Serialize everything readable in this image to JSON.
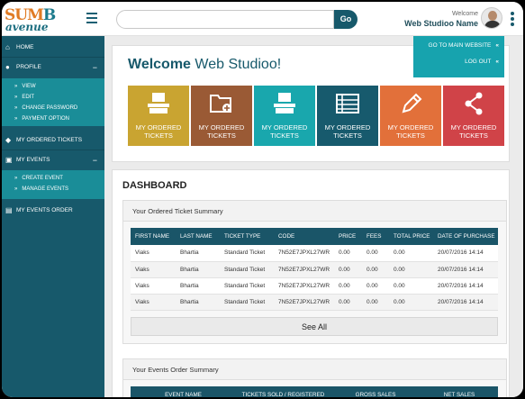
{
  "header": {
    "logo_line1": "SUM",
    "logo_line1_accent": "B",
    "logo_line2": "avenue",
    "search_placeholder": "",
    "go_label": "Go",
    "welcome_label": "Welcome",
    "user_name": "Web Studioo Name"
  },
  "user_menu": {
    "items": [
      {
        "label": "GO TO MAIN WEBSITE"
      },
      {
        "label": "LOG OUT"
      }
    ]
  },
  "sidebar": {
    "home": "HOME",
    "profile": "PROFILE",
    "profile_sub": [
      "VIEW",
      "EDIT",
      "CHANGE PASSWORD",
      "PAYMENT OPTION"
    ],
    "my_ordered_tickets": "MY ORDERED TICKETS",
    "my_events": "MY EVENTS",
    "events_sub": [
      "CREATE EVENT",
      "MANAGE EVENTS"
    ],
    "my_events_order": "MY EVENTS ORDER"
  },
  "welcome": {
    "prefix": "Welcome",
    "name": "Web Studioo!"
  },
  "tiles": [
    {
      "line1": "MY ORDERED",
      "line2": "TICKETS",
      "color": "#c9a431",
      "icon": "ticket-hand-icon"
    },
    {
      "line1": "MY ORDERED",
      "line2": "TICKETS",
      "color": "#9a5a35",
      "icon": "folder-add-icon"
    },
    {
      "line1": "MY ORDERED",
      "line2": "TICKETS",
      "color": "#19a7ad",
      "icon": "ticket-hand-icon"
    },
    {
      "line1": "MY ORDERED",
      "line2": "TICKETS",
      "color": "#175a6d",
      "icon": "list-icon"
    },
    {
      "line1": "MY ORDERED",
      "line2": "TICKETS",
      "color": "#e2703a",
      "icon": "pencil-icon"
    },
    {
      "line1": "MY ORDERED",
      "line2": "TICKETS",
      "color": "#d04348",
      "icon": "share-icon"
    }
  ],
  "dashboard": {
    "title": "DASHBOARD",
    "ticket_summary_title": "Your Ordered Ticket Summary",
    "ticket_columns": [
      "FIRST NAME",
      "LAST NAME",
      "TICKET TYPE",
      "CODE",
      "PRICE",
      "FEES",
      "TOTAL PRICE",
      "DATE OF PURCHASE"
    ],
    "ticket_rows": [
      [
        "Viaks",
        "Bhartia",
        "Standard Ticket",
        "7N52E7JPXL27WR",
        "0.00",
        "0.00",
        "0.00",
        "20/07/2016  14:14"
      ],
      [
        "Viaks",
        "Bhartia",
        "Standard Ticket",
        "7N52E7JPXL27WR",
        "0.00",
        "0.00",
        "0.00",
        "20/07/2016  14:14"
      ],
      [
        "Viaks",
        "Bhartia",
        "Standard Ticket",
        "7N52E7JPXL27WR",
        "0.00",
        "0.00",
        "0.00",
        "20/07/2016  14:14"
      ],
      [
        "Viaks",
        "Bhartia",
        "Standard Ticket",
        "7N52E7JPXL27WR",
        "0.00",
        "0.00",
        "0.00",
        "20/07/2016  14:14"
      ]
    ],
    "see_all": "See All",
    "events_summary_title": "Your Events Order Summary",
    "events_columns": [
      "EVENT NAME",
      "TICKETS SOLD / REGISTERED",
      "GROSS SALES",
      "NET SALES"
    ]
  },
  "colors": {
    "primary": "#17596b",
    "accent": "#17a3ae",
    "sidebar_sub": "#1a8d98"
  }
}
